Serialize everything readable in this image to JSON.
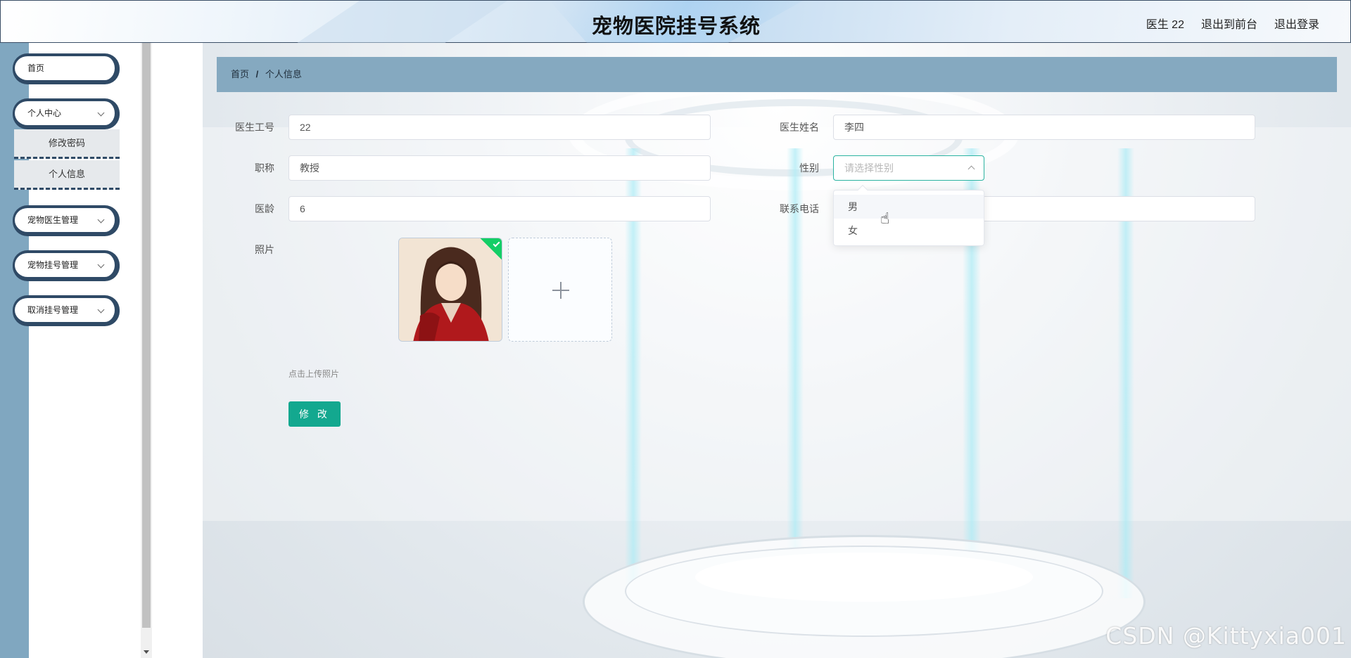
{
  "header": {
    "title": "宠物医院挂号系统",
    "user": "医生 22",
    "back_front": "退出到前台",
    "logout": "退出登录"
  },
  "sidebar": {
    "home": "首页",
    "personal_center": "个人中心",
    "change_password": "修改密码",
    "personal_info": "个人信息",
    "doctor_mgmt": "宠物医生管理",
    "register_mgmt": "宠物挂号管理",
    "cancel_mgmt": "取消挂号管理"
  },
  "breadcrumb": {
    "home": "首页",
    "separator": "/",
    "current": "个人信息"
  },
  "form": {
    "doctor_id_label": "医生工号",
    "doctor_id_value": "22",
    "doctor_name_label": "医生姓名",
    "doctor_name_value": "李四",
    "title_label": "职称",
    "title_value": "教授",
    "gender_label": "性别",
    "gender_placeholder": "请选择性别",
    "age_label": "医龄",
    "age_value": "6",
    "phone_label": "联系电话",
    "photo_label": "照片",
    "upload_hint": "点击上传照片",
    "submit": "修 改"
  },
  "gender_options": [
    "男",
    "女"
  ],
  "watermark": "CSDN @Kittyxia001",
  "colors": {
    "sidebar_strip": "#80a7c0",
    "breadcrumb_bg": "#85a9c0",
    "menu_border": "#2f4a66",
    "primary_button": "#13a88f",
    "select_focus": "#2bb3a1",
    "success_badge": "#13ce66"
  }
}
